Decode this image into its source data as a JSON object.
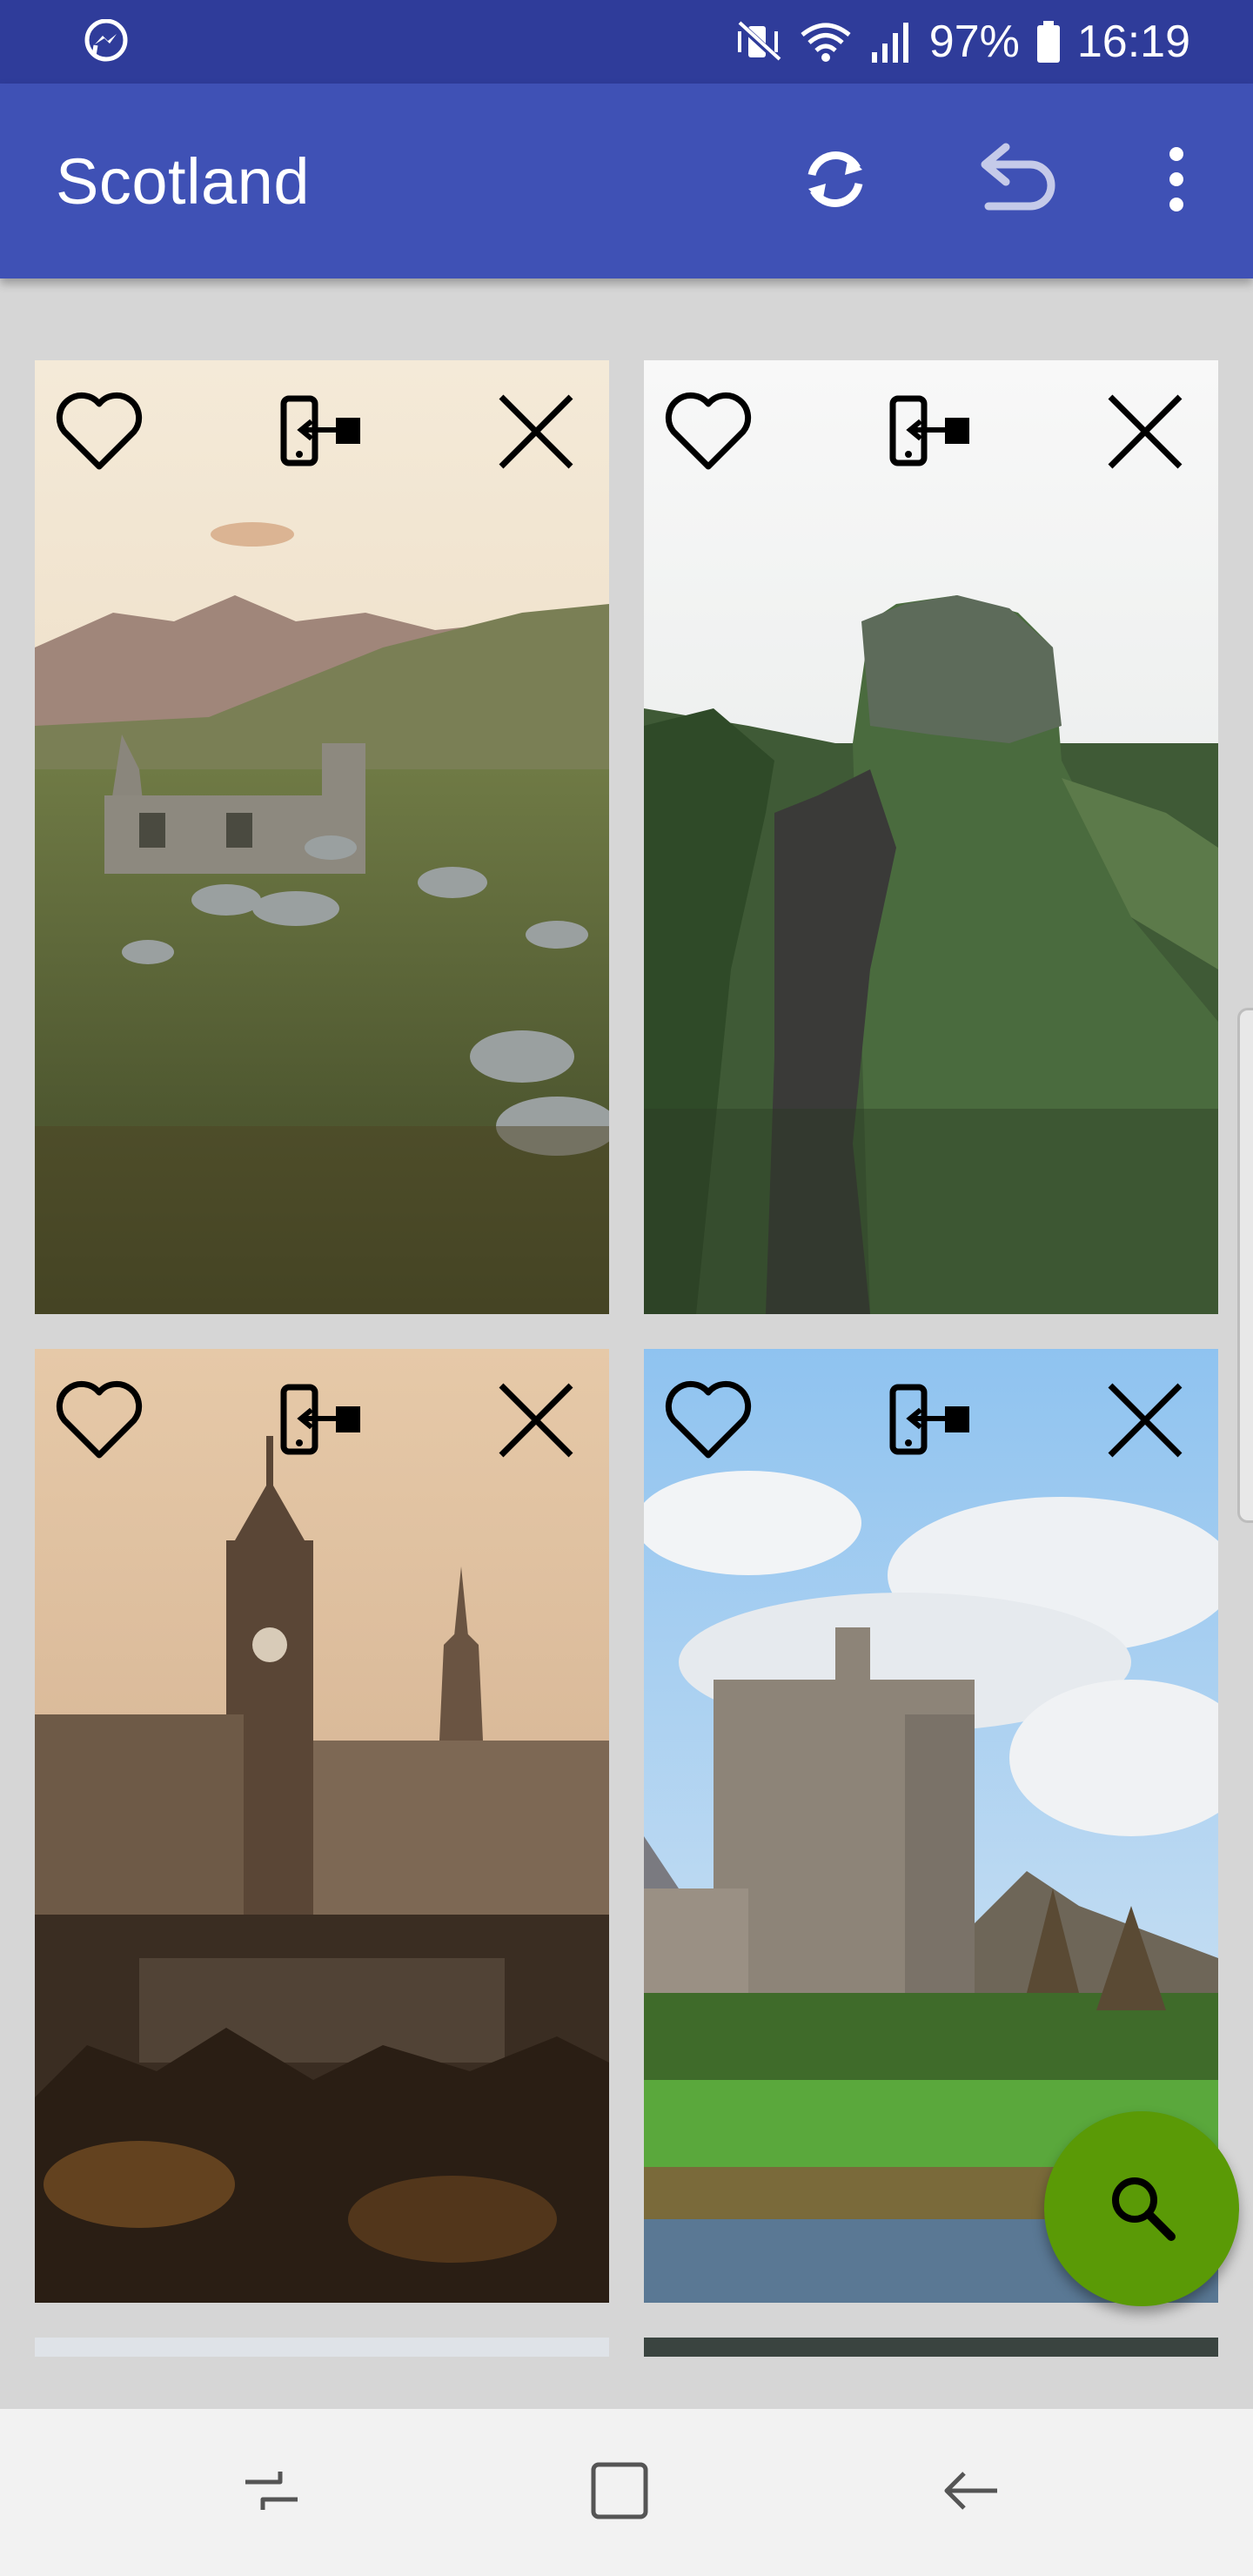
{
  "status_bar": {
    "left_icon": "messenger-icon",
    "right_icons": [
      "vibrate-mute-icon",
      "wifi-icon",
      "signal-icon",
      "battery-icon"
    ],
    "battery": "97%",
    "time": "16:19"
  },
  "app_bar": {
    "title": "Scotland",
    "actions": [
      "refresh-icon",
      "undo-icon",
      "more-vert-icon"
    ],
    "background": "#3f51b5"
  },
  "cards": [
    {
      "scene": "ruined-cottage-landscape",
      "actions": [
        "heart-icon",
        "set-wallpaper-icon",
        "close-icon"
      ]
    },
    {
      "scene": "fairy-glen-path",
      "actions": [
        "heart-icon",
        "set-wallpaper-icon",
        "close-icon"
      ]
    },
    {
      "scene": "edinburgh-skyline",
      "actions": [
        "heart-icon",
        "set-wallpaper-icon",
        "close-icon"
      ]
    },
    {
      "scene": "castle-by-water",
      "actions": [
        "heart-icon",
        "set-wallpaper-icon",
        "close-icon"
      ]
    }
  ],
  "fab": {
    "icon": "search-icon",
    "color": "#5a9a06"
  },
  "nav_bar": {
    "buttons": [
      "recents-icon",
      "home-icon",
      "back-icon"
    ]
  }
}
